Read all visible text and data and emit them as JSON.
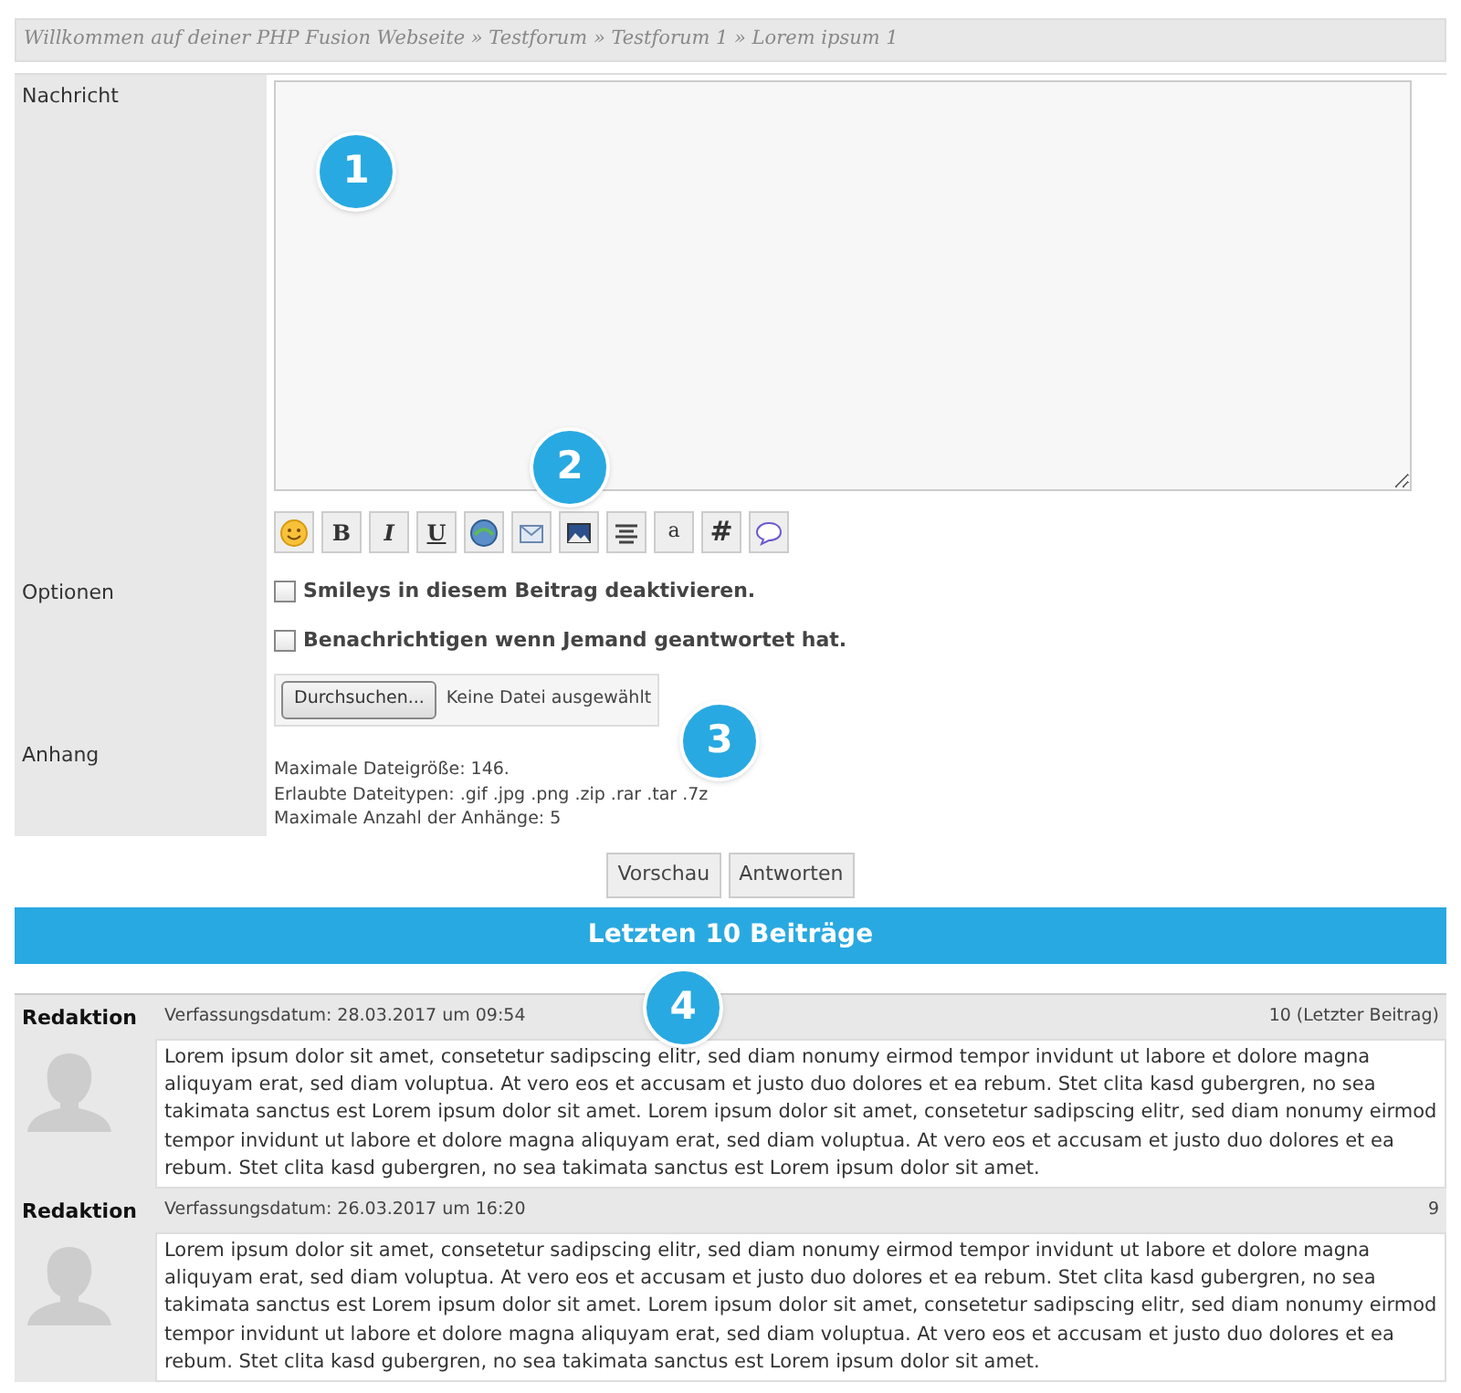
{
  "breadcrumb": "Willkommen auf deiner PHP Fusion Webseite » Testforum » Testforum 1 » Lorem ipsum 1",
  "form": {
    "message_label": "Nachricht",
    "options_label": "Optionen",
    "attachment_label": "Anhang",
    "toolbar": [
      {
        "kind": "smiley"
      },
      {
        "kind": "bold",
        "label": "B"
      },
      {
        "kind": "italic",
        "label": "I"
      },
      {
        "kind": "underline",
        "label": "U"
      },
      {
        "kind": "globe"
      },
      {
        "kind": "envelope"
      },
      {
        "kind": "image"
      },
      {
        "kind": "align"
      },
      {
        "kind": "letter",
        "label": "a"
      },
      {
        "kind": "hash",
        "label": "#"
      },
      {
        "kind": "bubble"
      }
    ],
    "options": [
      {
        "label": "Smileys in diesem Beitrag deaktivieren.",
        "checked": false
      },
      {
        "label": "Benachrichtigen wenn Jemand geantwortet hat.",
        "checked": false
      }
    ],
    "file_button": "Durchsuchen...",
    "file_status": "Keine Datei ausgewählt",
    "attachment_info": [
      "Maximale Dateigröße: 146.",
      "Erlaubte Dateitypen: .gif .jpg .png .zip .rar .tar .7z",
      "Maximale Anzahl der Anhänge: 5"
    ],
    "buttons": [
      "Vorschau",
      "Antworten"
    ]
  },
  "recent_bar": "Letzten 10 Beiträge",
  "posts": [
    {
      "author": "Redaktion",
      "date": "Verfassungsdatum: 28.03.2017 um 09:54",
      "number": "10 (Letzter Beitrag)",
      "body": "Lorem ipsum dolor sit amet, consetetur sadipscing elitr, sed diam nonumy eirmod tempor invidunt ut labore et dolore magna aliquyam erat, sed diam voluptua. At vero eos et accusam et justo duo dolores et ea rebum. Stet clita kasd gubergren, no sea takimata sanctus est Lorem ipsum dolor sit amet. Lorem ipsum dolor sit amet, consetetur sadipscing elitr, sed diam nonumy eirmod tempor invidunt ut labore et dolore magna aliquyam erat, sed diam voluptua. At vero eos et accusam et justo duo dolores et ea rebum. Stet clita kasd gubergren, no sea takimata sanctus est Lorem ipsum dolor sit amet."
    },
    {
      "author": "Redaktion",
      "date": "Verfassungsdatum: 26.03.2017 um 16:20",
      "number": "9",
      "body": "Lorem ipsum dolor sit amet, consetetur sadipscing elitr, sed diam nonumy eirmod tempor invidunt ut labore et dolore magna aliquyam erat, sed diam voluptua. At vero eos et accusam et justo duo dolores et ea rebum. Stet clita kasd gubergren, no sea takimata sanctus est Lorem ipsum dolor sit amet. Lorem ipsum dolor sit amet, consetetur sadipscing elitr, sed diam nonumy eirmod tempor invidunt ut labore et dolore magna aliquyam erat, sed diam voluptua. At vero eos et accusam et justo duo dolores et ea rebum. Stet clita kasd gubergren, no sea takimata sanctus est Lorem ipsum dolor sit amet."
    }
  ],
  "markers": [
    "1",
    "2",
    "3",
    "4"
  ]
}
